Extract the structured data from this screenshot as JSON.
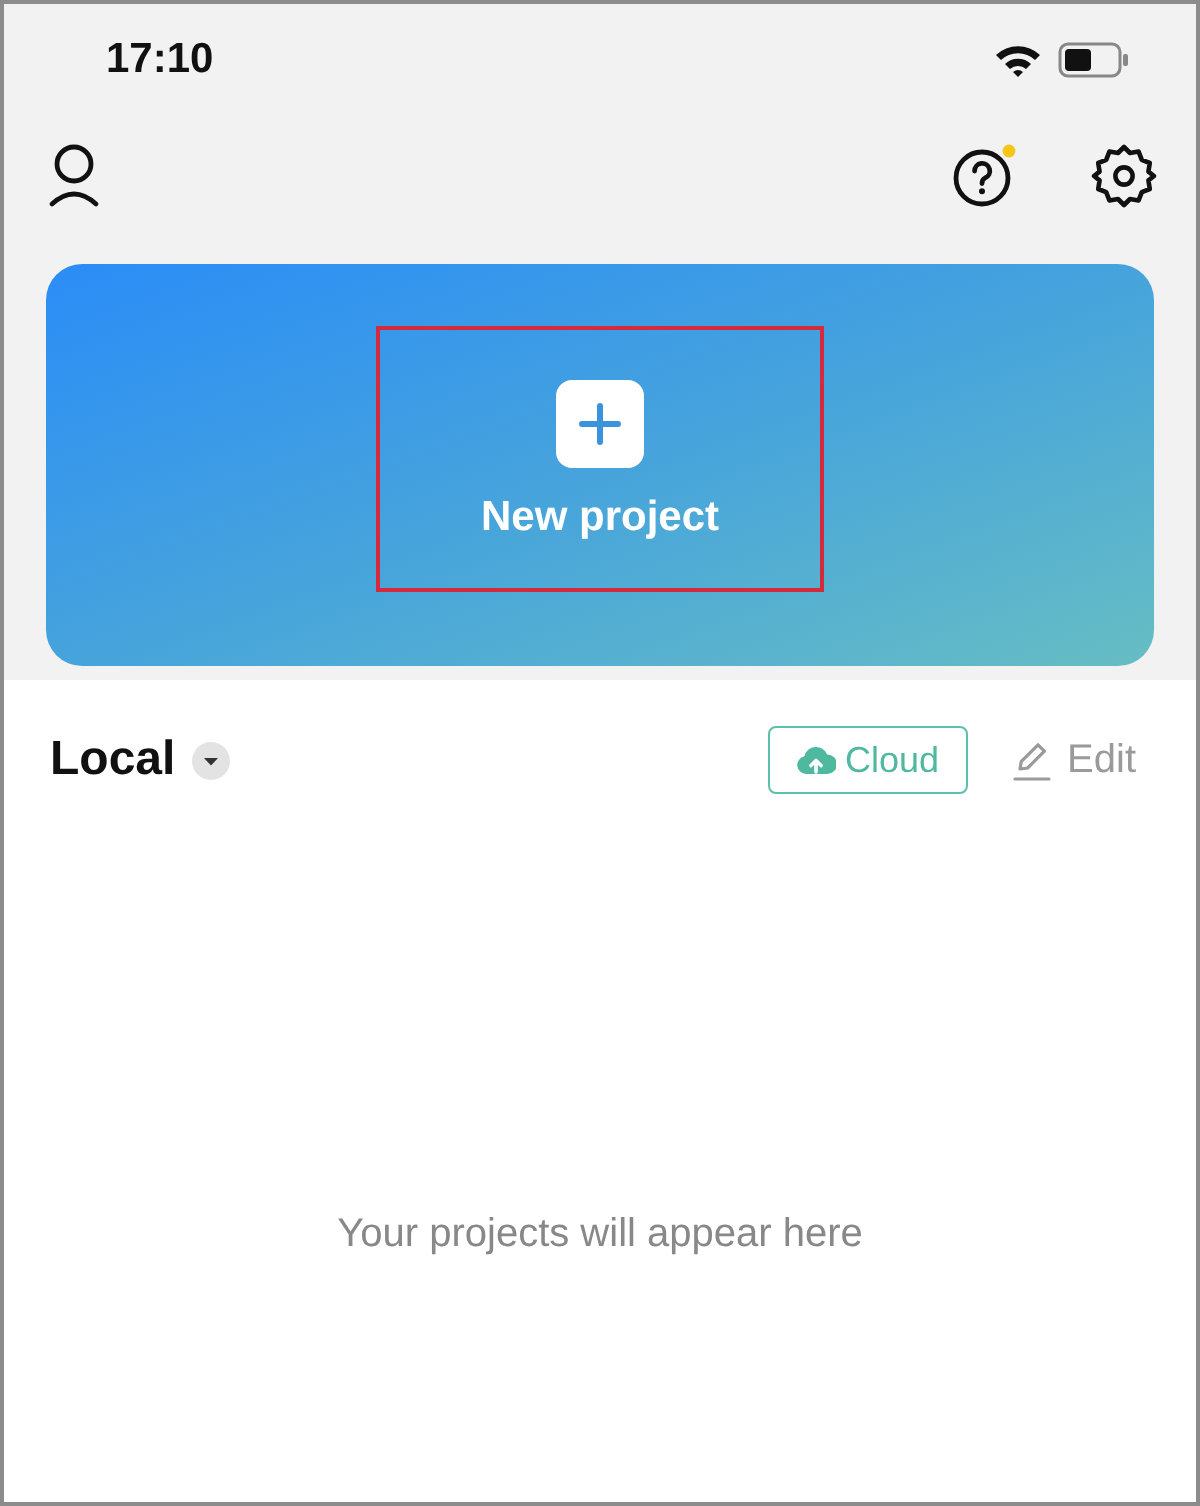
{
  "status_bar": {
    "time": "17:10"
  },
  "header": {
    "help": {
      "notification": true
    }
  },
  "new_project": {
    "label": "New project",
    "highlighted": true
  },
  "section": {
    "title": "Local",
    "cloud_button": "Cloud",
    "edit_button": "Edit"
  },
  "empty_state": {
    "text": "Your projects will appear here"
  }
}
